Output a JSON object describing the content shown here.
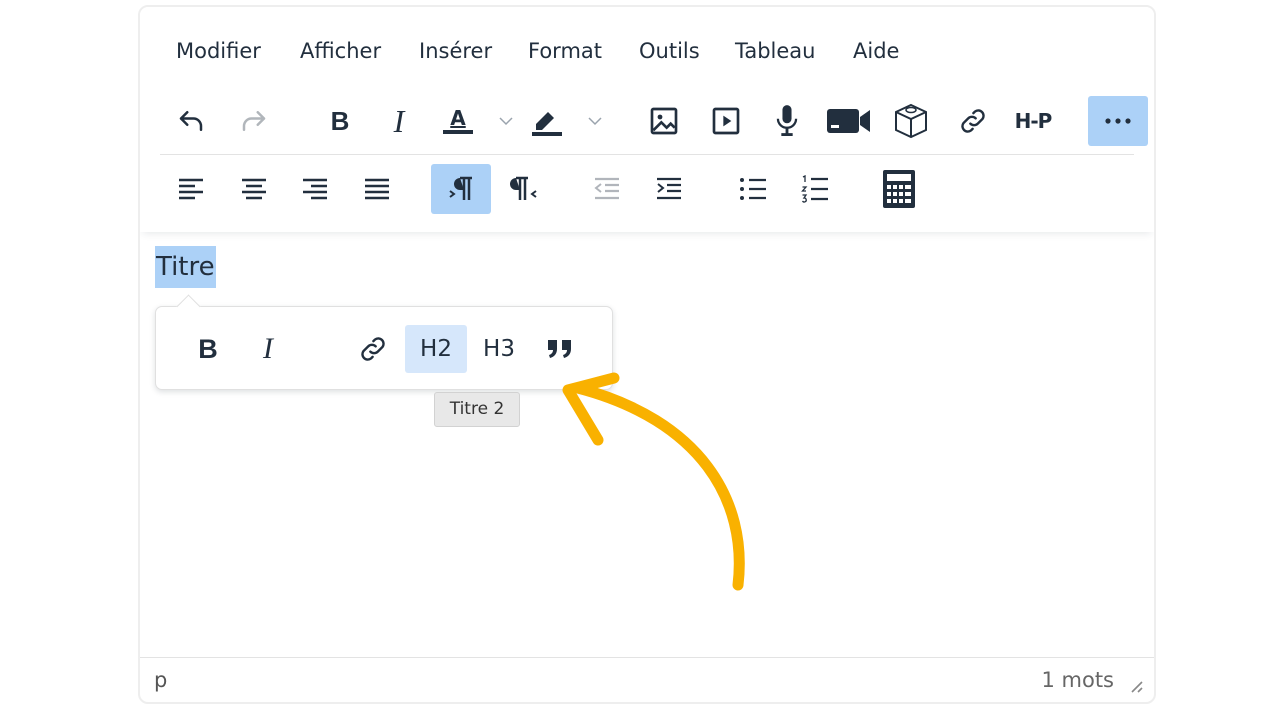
{
  "menubar": {
    "items": [
      "Modifier",
      "Afficher",
      "Insérer",
      "Format",
      "Outils",
      "Tableau",
      "Aide"
    ]
  },
  "toolbar": {
    "row1": [
      {
        "name": "undo-button",
        "icon": "undo-icon"
      },
      {
        "name": "redo-button",
        "icon": "redo-icon",
        "state": "disabled"
      },
      {
        "name": "bold-button",
        "icon": "bold-icon",
        "glyph": "B"
      },
      {
        "name": "italic-button",
        "icon": "italic-icon",
        "glyph": "I"
      },
      {
        "name": "text-color-button",
        "icon": "text-color-icon",
        "glyph": "A"
      },
      {
        "name": "highlight-color-button",
        "icon": "highlighter-icon"
      },
      {
        "name": "insert-image-button",
        "icon": "image-icon"
      },
      {
        "name": "insert-media-button",
        "icon": "play-icon"
      },
      {
        "name": "record-audio-button",
        "icon": "microphone-icon"
      },
      {
        "name": "record-video-button",
        "icon": "video-camera-icon"
      },
      {
        "name": "insert-3d-button",
        "icon": "cube-icon"
      },
      {
        "name": "insert-link-button",
        "icon": "link-icon"
      },
      {
        "name": "h5p-button",
        "icon": "h5p-icon",
        "glyph": "H-P"
      },
      {
        "name": "more-button",
        "icon": "more-icon",
        "state": "active"
      }
    ],
    "row2": [
      {
        "name": "align-left-button",
        "icon": "align-left-icon"
      },
      {
        "name": "align-center-button",
        "icon": "align-center-icon"
      },
      {
        "name": "align-right-button",
        "icon": "align-right-icon"
      },
      {
        "name": "align-justify-button",
        "icon": "align-justify-icon"
      },
      {
        "name": "ltr-button",
        "icon": "ltr-icon",
        "state": "active"
      },
      {
        "name": "rtl-button",
        "icon": "rtl-icon"
      },
      {
        "name": "outdent-button",
        "icon": "outdent-icon"
      },
      {
        "name": "indent-button",
        "icon": "indent-icon"
      },
      {
        "name": "bullet-list-button",
        "icon": "bullet-list-icon"
      },
      {
        "name": "numbered-list-button",
        "icon": "numbered-list-icon"
      },
      {
        "name": "calculator-button",
        "icon": "calculator-icon"
      }
    ]
  },
  "content": {
    "selected_text": "Titre"
  },
  "quickbar": {
    "bold_glyph": "B",
    "italic_glyph": "I",
    "h2_label": "H2",
    "h3_label": "H3",
    "active": "H2",
    "tooltip": "Titre 2"
  },
  "statusbar": {
    "path": "p",
    "word_count": "1 mots"
  },
  "colors": {
    "accent_active": "#acd1f7",
    "annotation_arrow": "#f9b100",
    "text": "#222f3e"
  }
}
